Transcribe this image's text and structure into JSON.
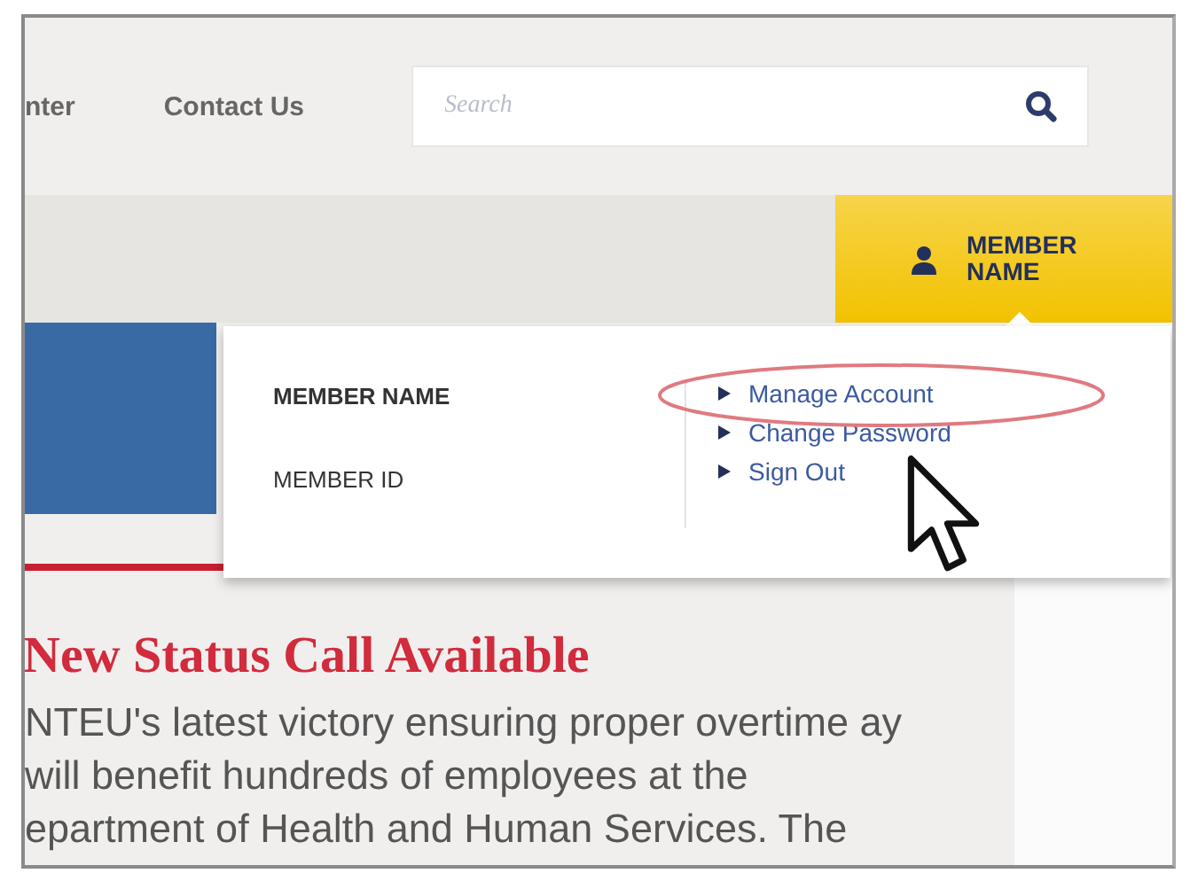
{
  "nav": {
    "links": [
      {
        "label": "nter"
      },
      {
        "label": "Contact Us"
      }
    ],
    "search": {
      "placeholder": "Search"
    }
  },
  "member_button": {
    "label": "MEMBER NAME",
    "expanded": true
  },
  "member_menu": {
    "name": "MEMBER NAME",
    "id": "MEMBER ID",
    "links": [
      {
        "label": "Manage Account",
        "highlighted": true
      },
      {
        "label": "Change Password",
        "highlighted": false
      },
      {
        "label": "Sign Out",
        "highlighted": false
      }
    ]
  },
  "article": {
    "headline": "New Status Call Available",
    "body": "NTEU's latest victory ensuring proper overtime ay will benefit hundreds of employees at the epartment of Health and Human Services. The"
  }
}
